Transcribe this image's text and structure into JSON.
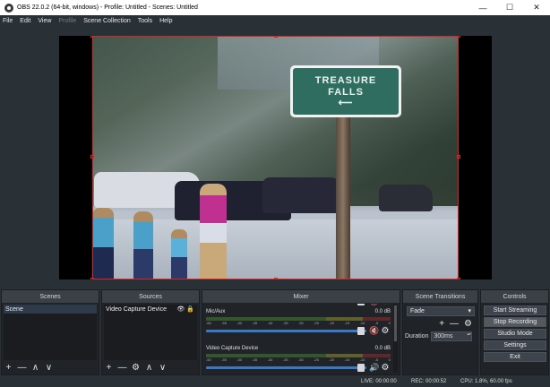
{
  "window": {
    "title": "OBS 22.0.2 (64-bit, windows) - Profile: Untitled - Scenes: Untitled",
    "controls": {
      "minimize": "—",
      "maximize": "☐",
      "close": "✕"
    }
  },
  "menu": {
    "items": [
      "File",
      "Edit",
      "View",
      "Profile",
      "Scene Collection",
      "Tools",
      "Help"
    ]
  },
  "preview": {
    "sign_line1": "TREASURE",
    "sign_line2": "FALLS",
    "sign_arrow": "⟵"
  },
  "scenes": {
    "title": "Scenes",
    "items": [
      "Scene"
    ],
    "toolbar": [
      "+",
      "—",
      "∧",
      "∨"
    ]
  },
  "sources": {
    "title": "Sources",
    "items": [
      "Video Capture Device"
    ],
    "item_icons": [
      "eye-icon",
      "lock-icon"
    ],
    "toolbar": [
      "+",
      "—",
      "⚙",
      "∧",
      "∨"
    ]
  },
  "mixer": {
    "title": "Mixer",
    "tracks": [
      {
        "name": "Mic/Aux",
        "level": "0.0 dB",
        "muted": true,
        "volume": 0.97
      },
      {
        "name": "Video Capture Device",
        "level": "0.0 dB",
        "muted": false,
        "volume": 0.97
      }
    ],
    "ticks": [
      "-60",
      "-55",
      "-50",
      "-45",
      "-40",
      "-35",
      "-30",
      "-25",
      "-20",
      "-15",
      "-10",
      "-5",
      "0"
    ]
  },
  "transitions": {
    "title": "Scene Transitions",
    "selected": "Fade",
    "duration_label": "Duration",
    "duration_value": "300ms",
    "toolbar": [
      "+",
      "—",
      "⚙"
    ]
  },
  "controls": {
    "title": "Controls",
    "buttons": [
      "Start Streaming",
      "Stop Recording",
      "Studio Mode",
      "Settings",
      "Exit"
    ]
  },
  "status": {
    "live": "LIVE: 00:00:00",
    "rec": "REC: 00:00:52",
    "cpu": "CPU: 1.8%, 60.00 fps"
  },
  "colors": {
    "background": "#293137",
    "selection": "#dd2222",
    "fader": "#3b79c7",
    "muted": "#e03030"
  }
}
